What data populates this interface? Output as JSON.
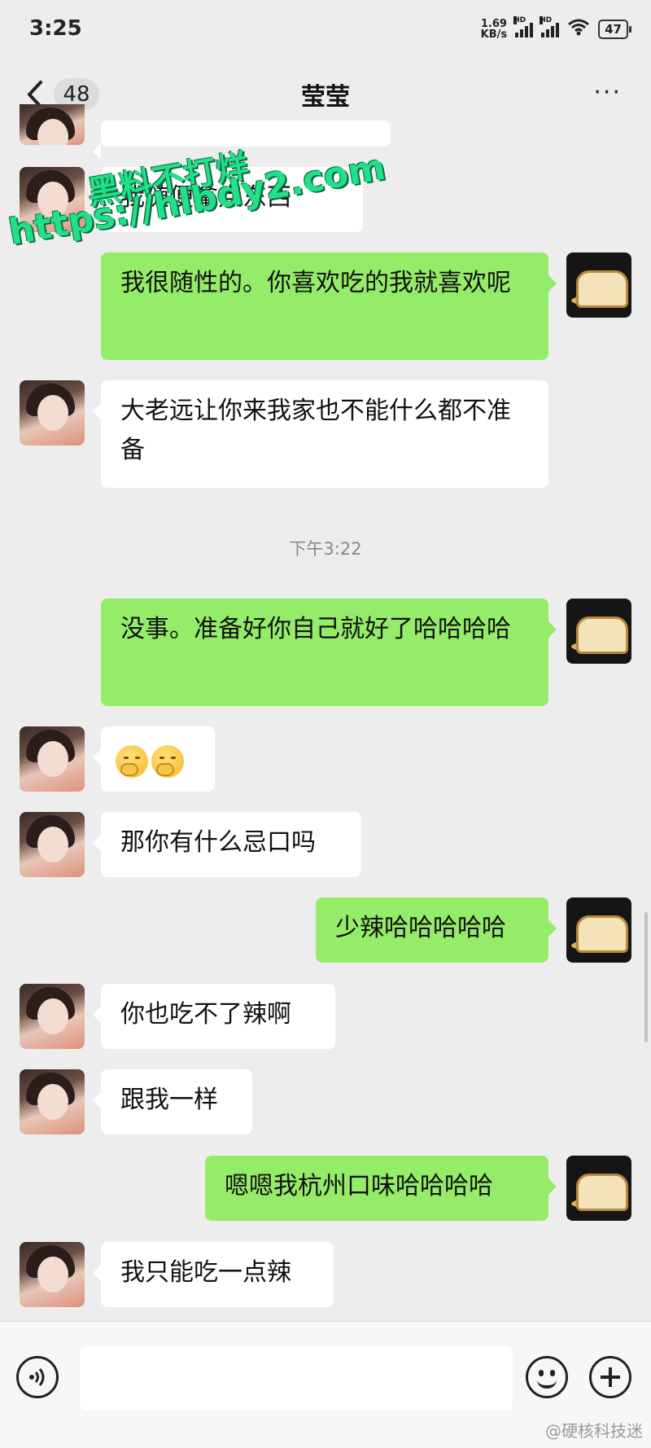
{
  "status_bar": {
    "time": "3:25",
    "net_speed_value": "1.69",
    "net_speed_unit": "KB/s",
    "hd_label": "HD",
    "wifi_icon": "wifi-icon",
    "battery": "47"
  },
  "header": {
    "unread_count": "48",
    "title": "莹莹",
    "more": "···"
  },
  "watermark": {
    "line1": "黑料不打烊",
    "line2": "https://hlbdy2.com"
  },
  "messages": [
    {
      "side": "left",
      "text": "我随便拿点东西"
    },
    {
      "side": "right",
      "text": "我很随性的。你喜欢吃的我就喜欢呢"
    },
    {
      "side": "left",
      "text": "大老远让你来我家也不能什么都不准备"
    },
    {
      "side": "right",
      "text": "没事。准备好你自己就好了哈哈哈哈"
    },
    {
      "side": "left",
      "text": ""
    },
    {
      "side": "left",
      "text": "那你有什么忌口吗"
    },
    {
      "side": "right",
      "text": "少辣哈哈哈哈哈"
    },
    {
      "side": "left",
      "text": "你也吃不了辣啊"
    },
    {
      "side": "left",
      "text": "跟我一样"
    },
    {
      "side": "right",
      "text": "嗯嗯我杭州口味哈哈哈哈"
    },
    {
      "side": "left",
      "text": "我只能吃一点辣"
    }
  ],
  "timestamp": "下午3:22",
  "input_bar": {
    "placeholder": ""
  },
  "weibo_watermark": "@硬核科技迷",
  "colors": {
    "background": "#ededed",
    "bubble_mine": "#95ec69",
    "bubble_theirs": "#ffffff"
  }
}
